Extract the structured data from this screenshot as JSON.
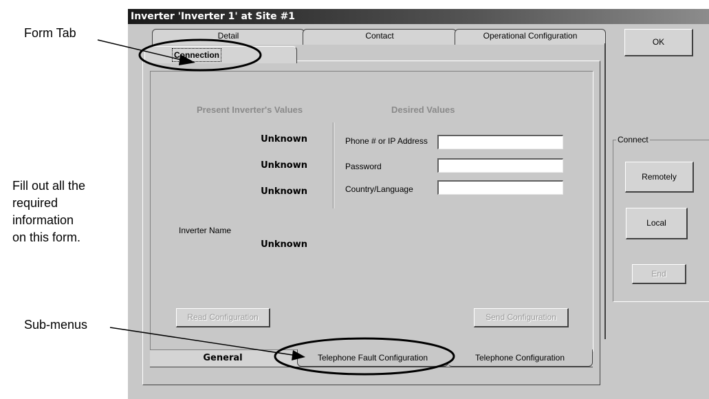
{
  "annotations": {
    "form_tab": "Form Tab",
    "instructions": [
      "Fill out all the",
      "required",
      "information",
      "on this form."
    ],
    "sub_menus": "Sub-menus"
  },
  "window": {
    "title": "Inverter 'Inverter 1' at Site #1"
  },
  "top_tabs": {
    "row_back": [
      "Detail",
      "Contact",
      "Operational Configuration"
    ],
    "active": "Connection"
  },
  "columns": {
    "present": "Present Inverter's Values",
    "desired": "Desired Values"
  },
  "present_values": [
    "Unknown",
    "Unknown",
    "Unknown"
  ],
  "fields": [
    {
      "label": "Phone # or IP Address",
      "value": ""
    },
    {
      "label": "Password",
      "value": ""
    },
    {
      "label": "Country/Language",
      "value": ""
    }
  ],
  "inverter_name": {
    "label": "Inverter Name",
    "value": "Unknown"
  },
  "buttons": {
    "read": "Read Configuration",
    "send": "Send Configuration",
    "ok": "OK",
    "remotely": "Remotely",
    "local": "Local",
    "end": "End"
  },
  "connect_group": {
    "label": "Connect"
  },
  "bottom_tabs": [
    "General",
    "Telephone Fault Configuration",
    "Telephone Configuration"
  ]
}
